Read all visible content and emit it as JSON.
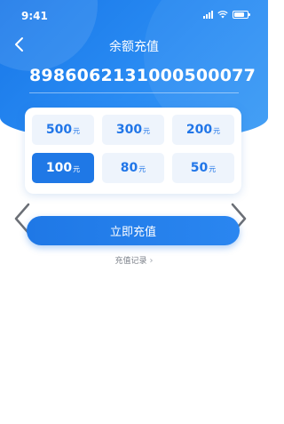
{
  "status_bar": {
    "time": "9:41"
  },
  "nav": {
    "title": "余额充值"
  },
  "phone": {
    "number": "8986062131000500077"
  },
  "amounts": [
    {
      "value": "500",
      "unit": "元",
      "selected": false
    },
    {
      "value": "300",
      "unit": "元",
      "selected": false
    },
    {
      "value": "200",
      "unit": "元",
      "selected": false
    },
    {
      "value": "100",
      "unit": "元",
      "selected": true
    },
    {
      "value": "80",
      "unit": "元",
      "selected": false
    },
    {
      "value": "50",
      "unit": "元",
      "selected": false
    }
  ],
  "actions": {
    "recharge_label": "立即充值",
    "history_label": "充值记录"
  },
  "colors": {
    "primary": "#1f78e6",
    "option_bg": "#eef4fc"
  }
}
